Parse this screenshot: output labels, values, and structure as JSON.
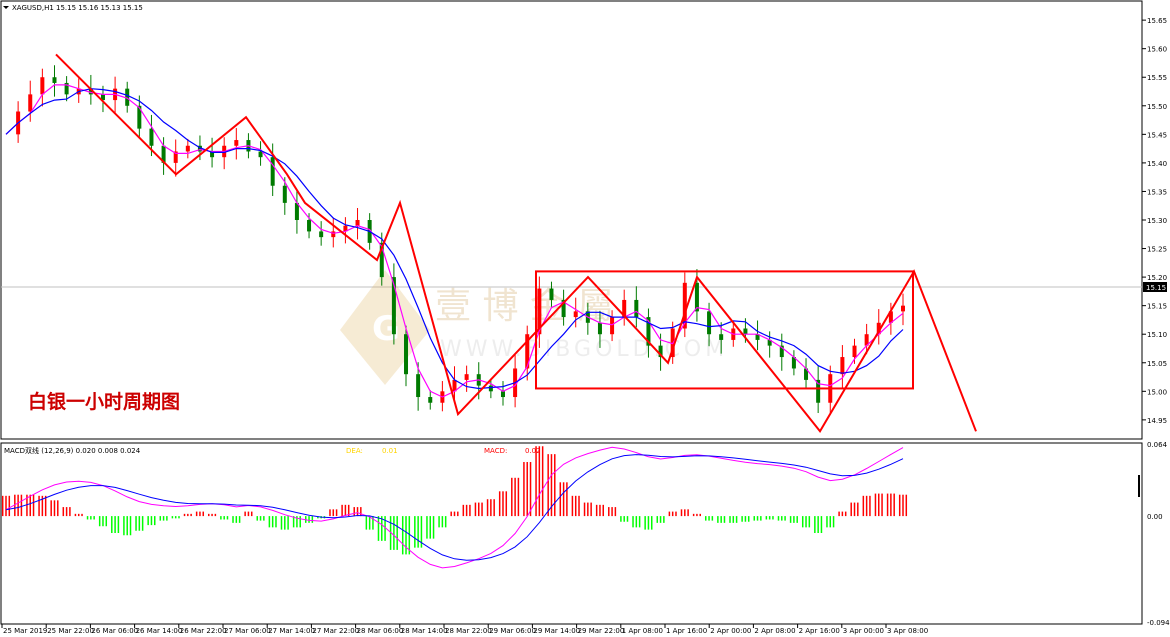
{
  "header": {
    "symbol_line": "XAGUSD,H1  15.15 15.16 15.13 15.15"
  },
  "overlay": {
    "title": "白银一小时周期图",
    "watermark_cn": "壹 博 金 屬",
    "watermark_en": "WWW.BIBGOLD.COM"
  },
  "macd_header": {
    "label": "MACD双线 (12,26,9) 0.020 0.008 0.024",
    "dea_label": "DEA:",
    "dea_value": "0.01",
    "macd_label": "MACD:",
    "macd_value": "0.02"
  },
  "colors": {
    "bull": "#ff0000",
    "bear": "#007a00",
    "ma_fast": "#ff00ff",
    "ma_slow": "#0000ff",
    "annotation": "#ff0000",
    "hist_pos": "#ff0000",
    "hist_neg": "#00ff00"
  },
  "chart_data": {
    "type": "candlestick",
    "symbol": "XAGUSD",
    "timeframe": "H1",
    "price_axis": {
      "range": [
        14.92,
        15.68
      ],
      "ticks": [
        "15.65",
        "15.60",
        "15.55",
        "15.50",
        "15.45",
        "15.40",
        "15.35",
        "15.30",
        "15.25",
        "15.20",
        "15.15",
        "15.10",
        "15.05",
        "15.00",
        "14.95"
      ],
      "current_price": "15.15"
    },
    "time_labels": [
      "25 Mar 2019",
      "25 Mar 22:00",
      "26 Mar 06:00",
      "26 Mar 14:00",
      "26 Mar 22:00",
      "27 Mar 06:00",
      "27 Mar 14:00",
      "27 Mar 22:00",
      "28 Mar 06:00",
      "28 Mar 14:00",
      "28 Mar 22:00",
      "29 Mar 06:00",
      "29 Mar 14:00",
      "29 Mar 22:00",
      "1 Apr 08:00",
      "1 Apr 16:00",
      "2 Apr 00:00",
      "2 Apr 08:00",
      "2 Apr 16:00",
      "3 Apr 00:00",
      "3 Apr 08:00"
    ],
    "macd_axis": {
      "range": [
        -0.094,
        0.064
      ],
      "ticks": [
        "0.064",
        "0.00",
        "-0.094"
      ]
    },
    "price_path": [
      15.45,
      15.49,
      15.52,
      15.55,
      15.54,
      15.52,
      15.53,
      15.52,
      15.51,
      15.53,
      15.5,
      15.46,
      15.43,
      15.4,
      15.42,
      15.43,
      15.42,
      15.41,
      15.43,
      15.44,
      15.42,
      15.41,
      15.36,
      15.33,
      15.3,
      15.28,
      15.27,
      15.28,
      15.29,
      15.3,
      15.26,
      15.2,
      15.1,
      15.03,
      14.99,
      14.98,
      15.0,
      15.02,
      15.03,
      15.01,
      15.0,
      14.99,
      15.04,
      15.1,
      15.18,
      15.16,
      15.13,
      15.14,
      15.12,
      15.1,
      15.13,
      15.16,
      15.13,
      15.08,
      15.06,
      15.11,
      15.19,
      15.14,
      15.1,
      15.09,
      15.11,
      15.1,
      15.09,
      15.08,
      15.06,
      15.04,
      15.02,
      14.98,
      15.03,
      15.06,
      15.08,
      15.1,
      15.12,
      15.14,
      15.15
    ],
    "macd_histogram": [
      0.018,
      0.019,
      0.019,
      0.018,
      0.014,
      0.008,
      0.002,
      -0.003,
      -0.009,
      -0.015,
      -0.017,
      -0.013,
      -0.008,
      -0.004,
      -0.002,
      0.002,
      0.004,
      0.002,
      -0.003,
      -0.006,
      0.004,
      -0.004,
      -0.01,
      -0.012,
      -0.01,
      -0.006,
      -0.002,
      0.006,
      0.01,
      0.008,
      -0.012,
      -0.022,
      -0.03,
      -0.034,
      -0.028,
      -0.02,
      -0.01,
      0.004,
      0.01,
      0.012,
      0.015,
      0.022,
      0.034,
      0.048,
      0.062,
      0.055,
      0.03,
      0.018,
      0.012,
      0.01,
      0.008,
      -0.005,
      -0.01,
      -0.012,
      -0.006,
      0.004,
      0.006,
      0.002,
      -0.004,
      -0.006,
      -0.006,
      -0.005,
      -0.004,
      -0.003,
      -0.004,
      -0.006,
      -0.01,
      -0.015,
      -0.01,
      0.004,
      0.012,
      0.018,
      0.02,
      0.02,
      0.019
    ],
    "annotations": {
      "range_box": {
        "price_top": 15.21,
        "price_bottom": 15.005
      },
      "wave_points": [
        [
          15.59,
          56
        ],
        [
          15.52,
          96
        ],
        [
          15.38,
          176
        ],
        [
          15.48,
          246
        ],
        [
          15.38,
          287
        ],
        [
          15.33,
          305
        ],
        [
          15.23,
          377
        ],
        [
          15.33,
          400
        ],
        [
          14.96,
          458
        ],
        [
          15.2,
          588
        ],
        [
          15.05,
          668
        ],
        [
          15.2,
          697
        ],
        [
          14.93,
          820
        ],
        [
          15.21,
          914
        ],
        [
          14.93,
          976
        ]
      ]
    }
  }
}
